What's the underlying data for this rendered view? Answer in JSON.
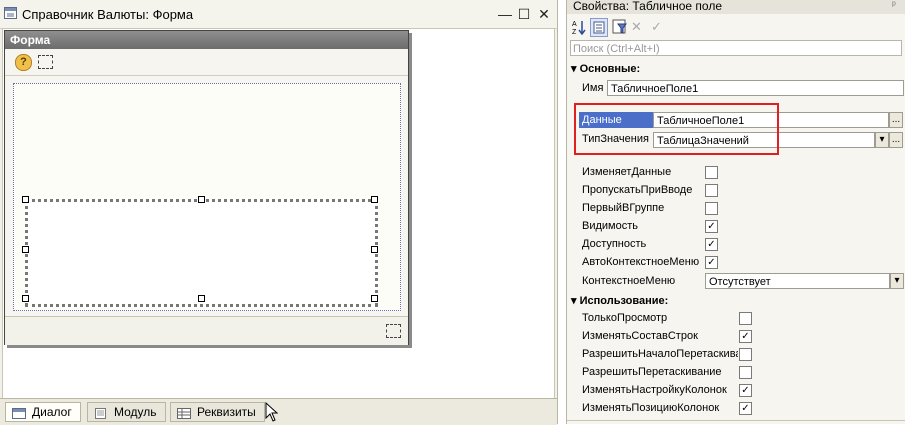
{
  "designer": {
    "title": "Справочник Валюты: Форма",
    "form_caption": "Форма",
    "tabs": [
      {
        "label": "Диалог",
        "active": true
      },
      {
        "label": "Модуль",
        "active": false
      },
      {
        "label": "Реквизиты",
        "active": false
      }
    ],
    "win_min": "—",
    "win_max": "☐",
    "win_close": "✕",
    "help_glyph": "?"
  },
  "props": {
    "title": "Свойства: Табличное поле",
    "pin": "ᵖ",
    "search_placeholder": "Поиск (Ctrl+Alt+I)",
    "section_main": "Основные:",
    "name_label": "Имя",
    "name_value": "ТабличноеПоле1",
    "data_label": "Данные",
    "data_value": "ТабличноеПоле1",
    "type_label": "ТипЗначения",
    "type_value": "ТаблицаЗначений",
    "ellipsis": "...",
    "dropdown": "▾",
    "main_items": [
      {
        "label": "ИзменяетДанные",
        "checked": false
      },
      {
        "label": "ПропускатьПриВводе",
        "checked": false
      },
      {
        "label": "ПервыйВГруппе",
        "checked": false
      },
      {
        "label": "Видимость",
        "checked": true
      },
      {
        "label": "Доступность",
        "checked": true
      },
      {
        "label": "АвтоКонтекстноеМеню",
        "checked": true
      }
    ],
    "context_menu_label": "КонтекстноеМеню",
    "context_menu_value": "Отсутствует",
    "section_usage": "Использование:",
    "usage_items": [
      {
        "label": "ТолькоПросмотр",
        "checked": false
      },
      {
        "label": "ИзменятьСоставСтрок",
        "checked": true
      },
      {
        "label": "РазрешитьНачалоПеретаскива",
        "checked": false
      },
      {
        "label": "РазрешитьПеретаскивание",
        "checked": false
      },
      {
        "label": "ИзменятьНастройкуКолонок",
        "checked": true
      },
      {
        "label": "ИзменятьПозициюКолонок",
        "checked": true
      }
    ],
    "check_mark": "✓",
    "section_arrow": "▾"
  }
}
